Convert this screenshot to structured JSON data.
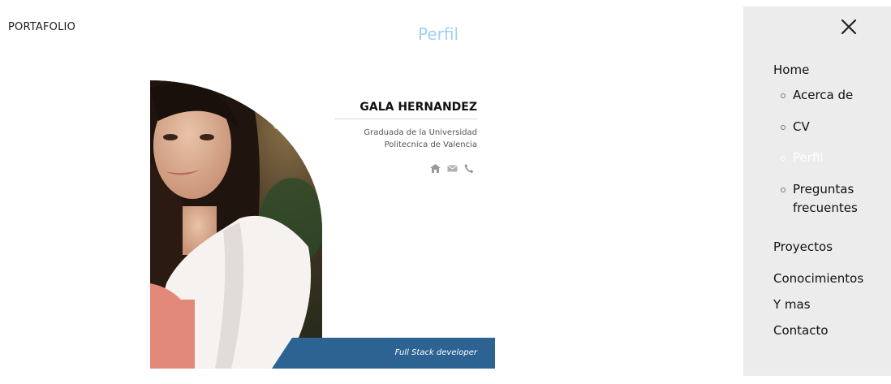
{
  "header": {
    "brand": "PORTAFOLIO",
    "page_title": "Perfil"
  },
  "profile_card": {
    "name": "GALA HERNANDEZ",
    "bio": "Graduada de la Universidad Politecnica de Valencia",
    "role": "Full Stack developer",
    "contact_icons": [
      "home-icon",
      "mail-icon",
      "phone-icon"
    ],
    "colors": {
      "ribbon": "#2d6393",
      "title": "#9fd0f5"
    }
  },
  "side_menu": {
    "close_icon": "close-icon",
    "items": {
      "home": "Home",
      "acerca": "Acerca de",
      "cv": "CV",
      "perfil": "Perfil",
      "preguntas": "Preguntas frecuentes",
      "proyectos": "Proyectos",
      "conocimientos": "Conocimientos",
      "ymas": "Y mas",
      "contacto": "Contacto"
    },
    "active_item": "Perfil"
  }
}
